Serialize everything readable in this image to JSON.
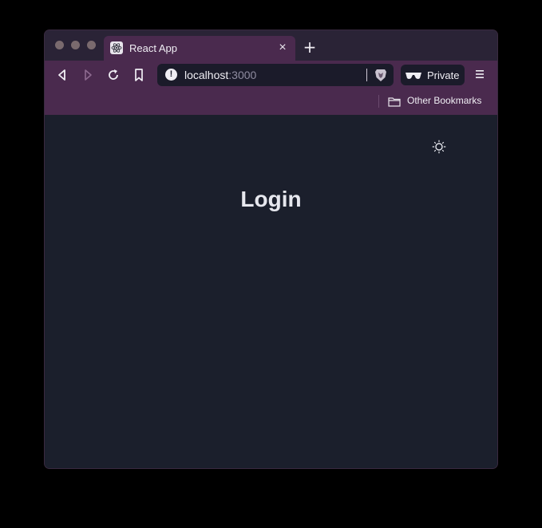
{
  "browser": {
    "tab": {
      "title": "React App",
      "favicon": "react-icon",
      "close_glyph": "×"
    },
    "new_tab_glyph": "+",
    "toolbar": {
      "back_icon": "back-icon",
      "forward_icon": "forward-icon",
      "reload_icon": "reload-icon",
      "bookmark_icon": "bookmark-icon",
      "url_host": "localhost",
      "url_port": ":3000",
      "site_info_glyph": "!",
      "shields_icon": "brave-shields-icon",
      "private_label": "Private",
      "menu_icon": "hamburger-menu-icon"
    },
    "bookmarks_bar": {
      "items": [
        {
          "label": "Other Bookmarks",
          "icon": "folder-icon"
        }
      ]
    }
  },
  "page": {
    "theme_toggle_icon": "sun-icon",
    "heading": "Login"
  },
  "colors": {
    "chrome_accent": "#4a2a4e",
    "page_background": "#1b1f2c",
    "heading_text": "#e6e7ee"
  }
}
